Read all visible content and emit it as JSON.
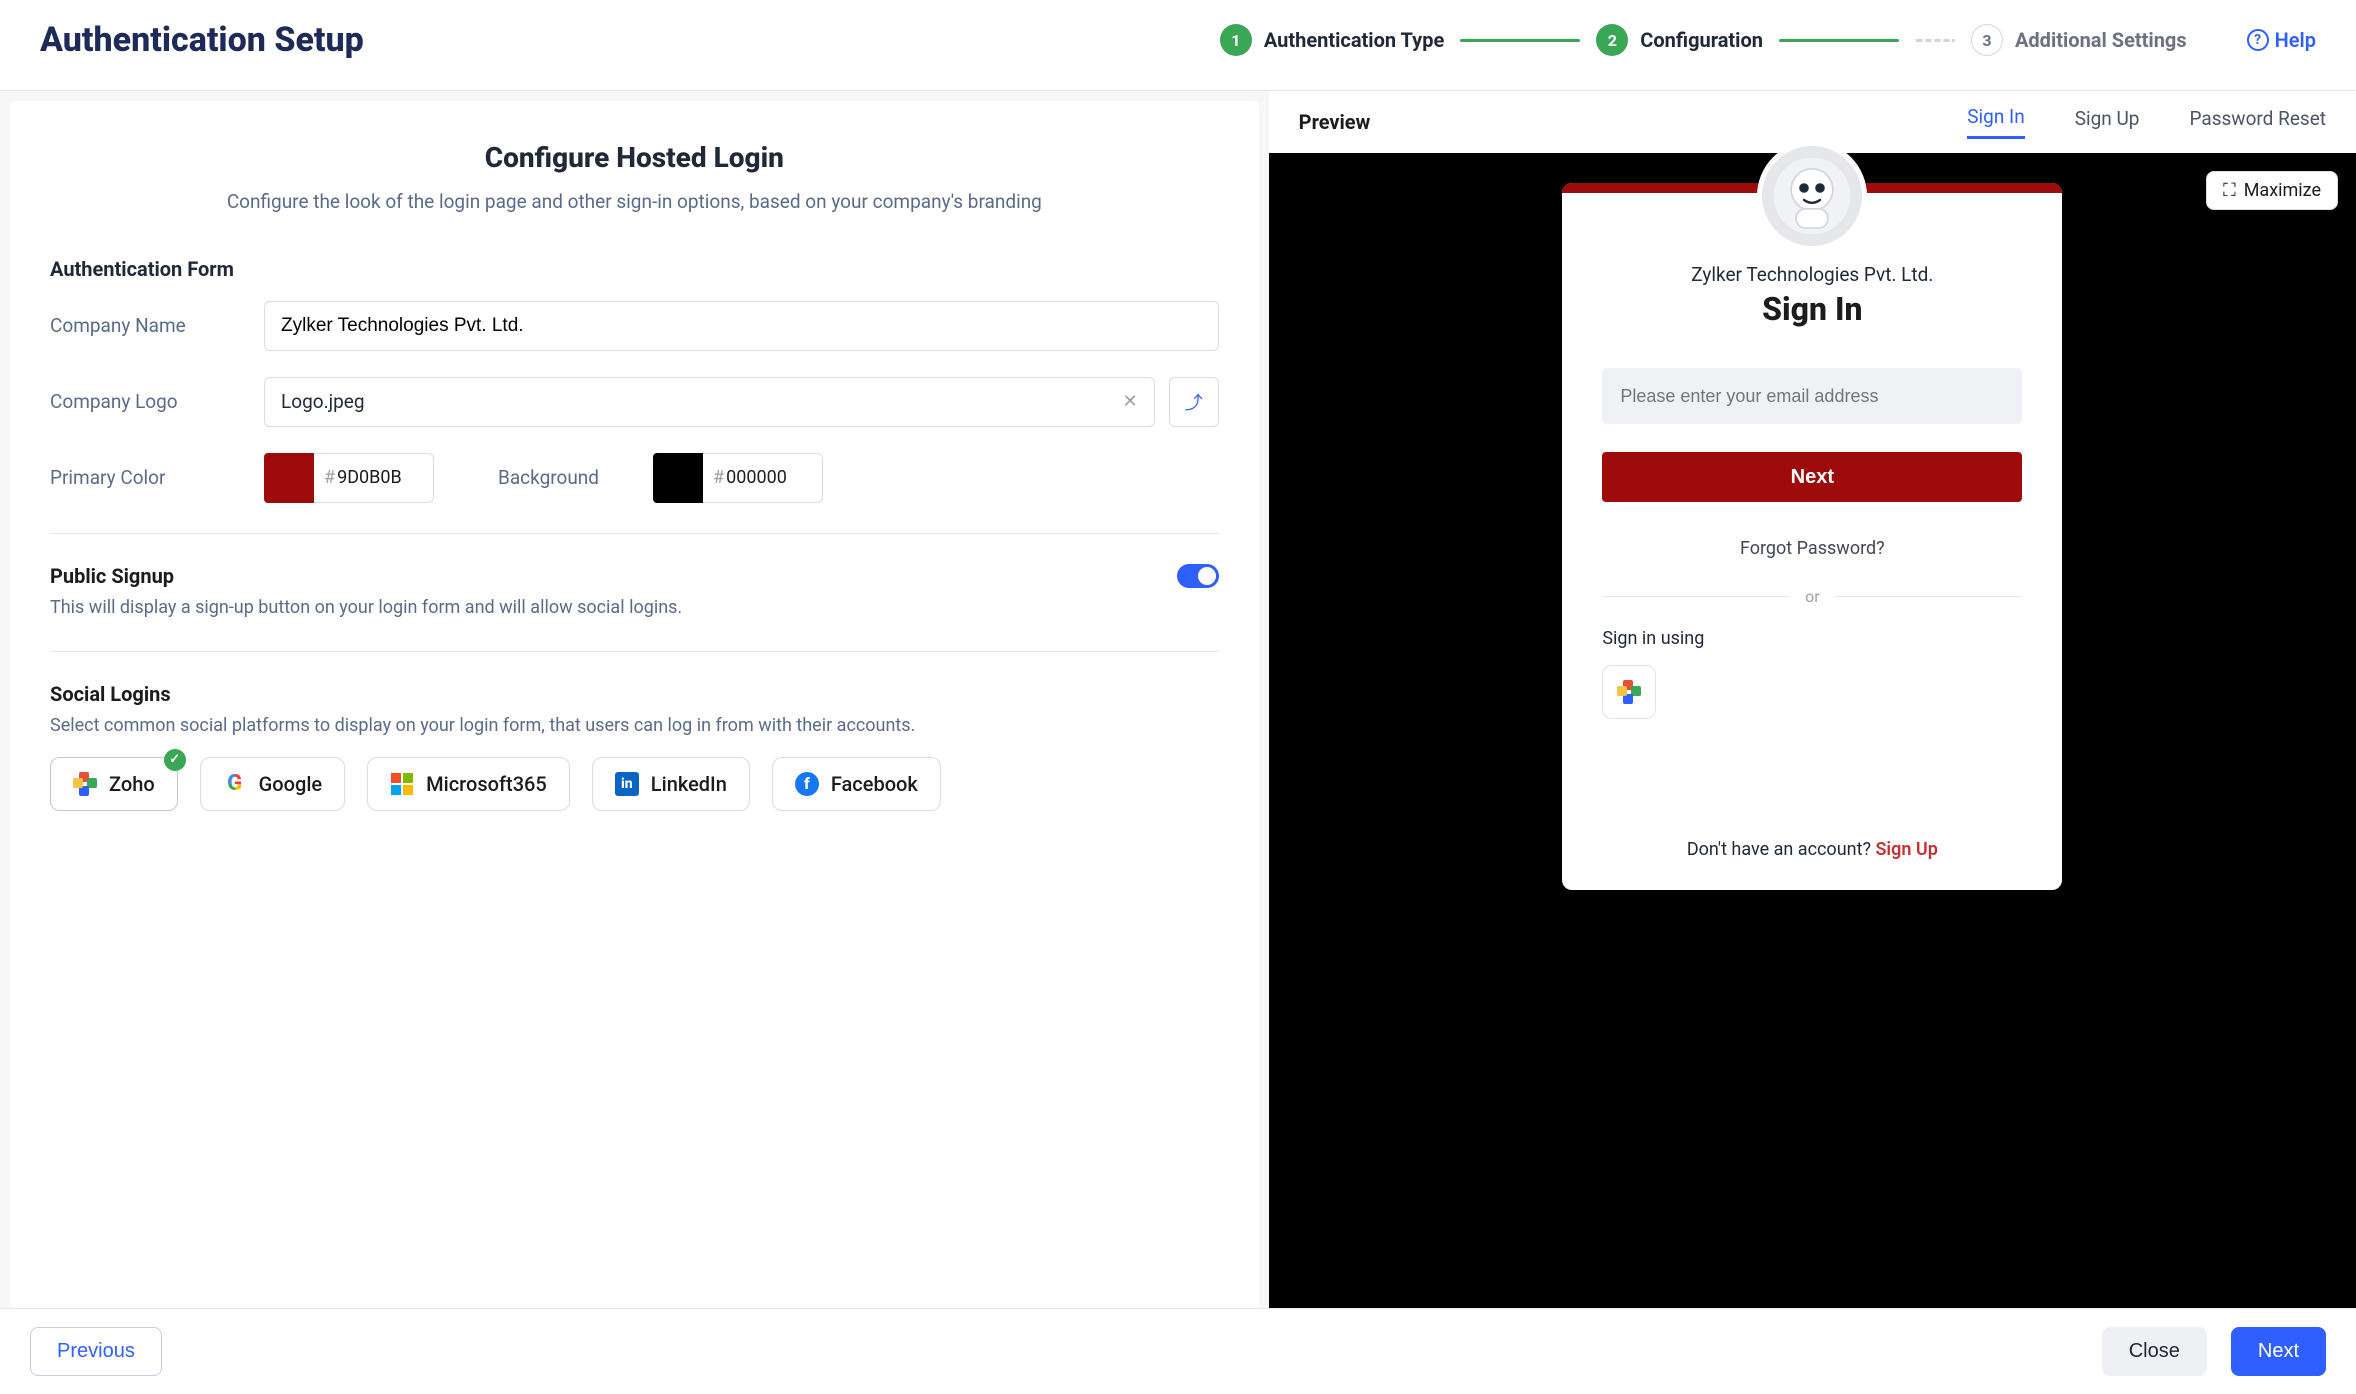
{
  "header": {
    "title": "Authentication Setup",
    "steps": [
      {
        "num": "1",
        "label": "Authentication Type"
      },
      {
        "num": "2",
        "label": "Configuration"
      },
      {
        "num": "3",
        "label": "Additional Settings"
      }
    ],
    "help": "Help"
  },
  "config": {
    "title": "Configure Hosted Login",
    "subtitle": "Configure the look of the login page and other sign-in options, based on your company's branding",
    "form_section": "Authentication Form",
    "company_name_label": "Company Name",
    "company_name_value": "Zylker Technologies Pvt. Ltd.",
    "company_logo_label": "Company Logo",
    "company_logo_value": "Logo.jpeg",
    "primary_color_label": "Primary Color",
    "primary_color_value": "9D0B0B",
    "primary_color_swatch": "#9D0B0B",
    "background_label": "Background",
    "background_value": "000000",
    "background_swatch": "#000000",
    "public_signup_title": "Public Signup",
    "public_signup_desc": "This will display a sign-up button on your login form and will allow social logins.",
    "social_title": "Social Logins",
    "social_desc": "Select common social platforms to display on your login form, that users can log in from with their accounts.",
    "social": [
      {
        "name": "Zoho",
        "selected": true
      },
      {
        "name": "Google",
        "selected": false
      },
      {
        "name": "Microsoft365",
        "selected": false
      },
      {
        "name": "LinkedIn",
        "selected": false
      },
      {
        "name": "Facebook",
        "selected": false
      }
    ]
  },
  "preview": {
    "label": "Preview",
    "tabs": {
      "signin": "Sign In",
      "signup": "Sign Up",
      "reset": "Password Reset"
    },
    "maximize": "Maximize",
    "company": "Zylker Technologies Pvt. Ltd.",
    "heading": "Sign In",
    "email_placeholder": "Please enter your email address",
    "next": "Next",
    "forgot": "Forgot Password?",
    "or": "or",
    "using": "Sign in using",
    "no_account": "Don't have an account? ",
    "signup_link": "Sign Up"
  },
  "footer": {
    "previous": "Previous",
    "close": "Close",
    "next": "Next"
  }
}
